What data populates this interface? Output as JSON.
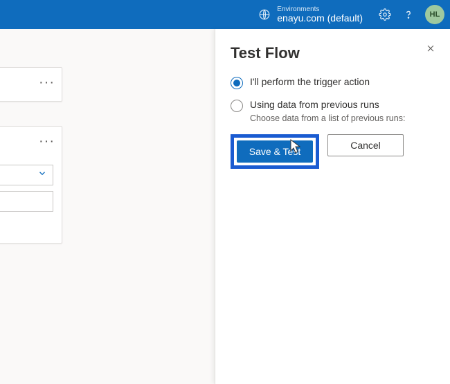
{
  "header": {
    "env_label": "Environments",
    "env_name": "enayu.com (default)",
    "avatar_initials": "HL"
  },
  "panel": {
    "title": "Test Flow",
    "option1_label": "I'll perform the trigger action",
    "option2_label": "Using data from previous runs",
    "option2_sub": "Choose data from a list of previous runs:",
    "primary_button": "Save & Test",
    "secondary_button": "Cancel"
  }
}
